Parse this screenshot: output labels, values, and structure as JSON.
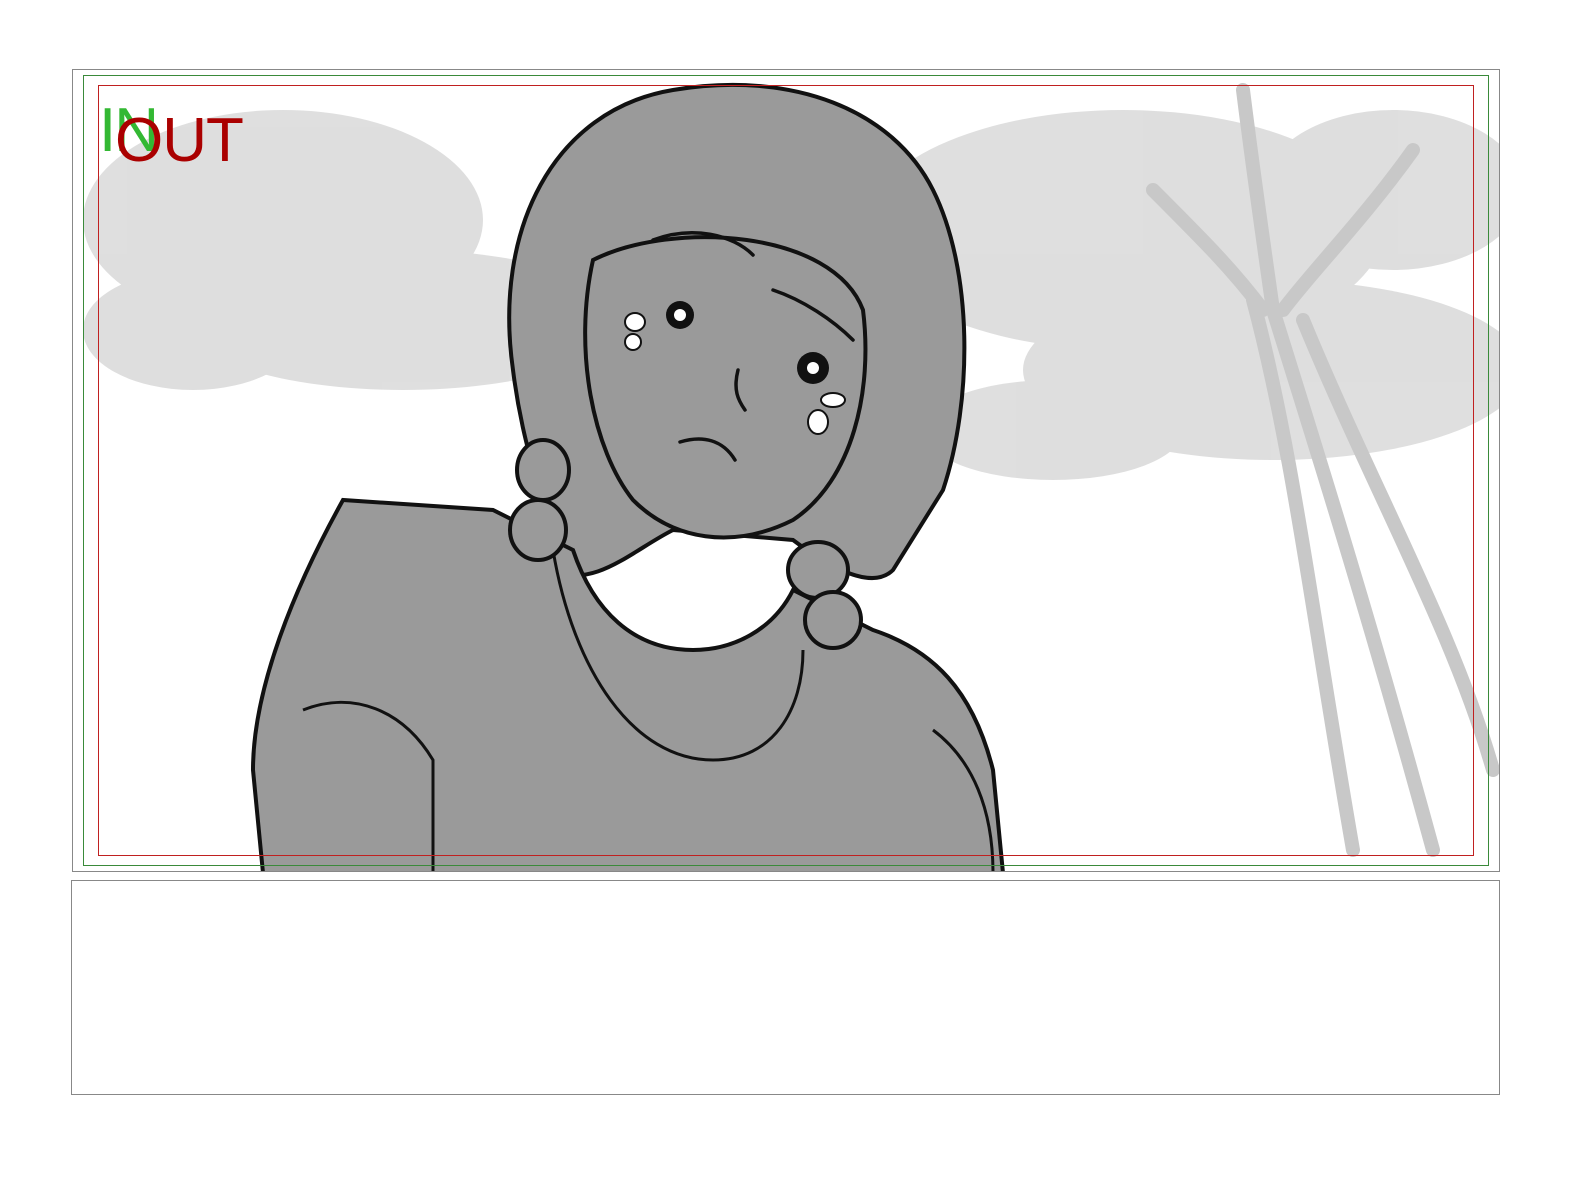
{
  "storyboard": {
    "frame_labels": {
      "in": "IN",
      "out": "OUT"
    },
    "colors": {
      "in_frame": "#3a8a3a",
      "out_frame": "#c02020",
      "in_text": "#33b833",
      "out_text": "#aa0000",
      "tone": "#999999"
    },
    "notes_text": ""
  }
}
